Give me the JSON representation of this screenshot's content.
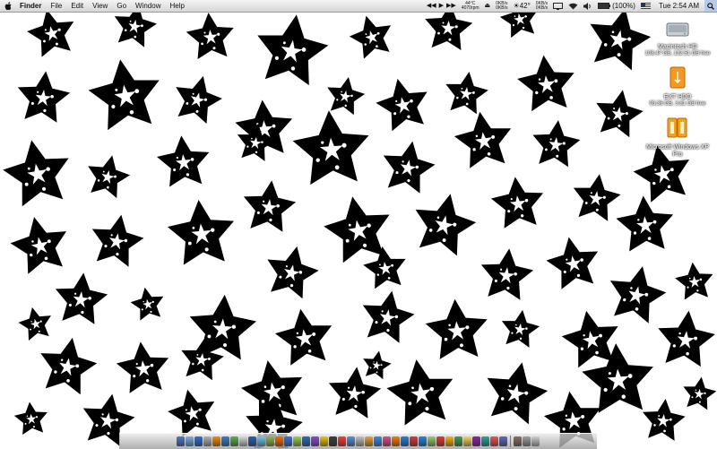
{
  "menubar": {
    "app_name": "Finder",
    "menus": [
      "File",
      "Edit",
      "View",
      "Go",
      "Window",
      "Help"
    ],
    "temperature_cpu": "44°C",
    "rpm": "4070rpm",
    "net_up": "0KB/s",
    "net_down": "0KB/s",
    "weather": "42°",
    "disk_io_1": "0KB/s",
    "disk_io_2": "0KB/s",
    "battery": "(100%)",
    "clock": "Tue 2:54 AM"
  },
  "desktop_icons": [
    {
      "name": "Macintosh HD",
      "sub": "108.47 GB, 132.51 GB free",
      "kind": "hard-drive-icon"
    },
    {
      "name": "EXT HDD",
      "sub": "93.36 GB, 3.81 GB free",
      "kind": "external-drive-icon"
    },
    {
      "name": "Microsoft Windows XP Pro",
      "sub": "",
      "kind": "windows-partition-icon"
    }
  ],
  "dock": {
    "colors": [
      "#4a7bd0",
      "#7bb0e8",
      "#2f6fd8",
      "#b2b2b2",
      "#ff8a00",
      "#3c7dc8",
      "#58b24a",
      "#d9d9d9",
      "#2b5fb8",
      "#6dc9f0",
      "#8fb84a",
      "#ff6a00",
      "#3476d4",
      "#9ad04a",
      "#2a6cc0",
      "#8a4ad0",
      "#f2c400",
      "#3c3c3c",
      "#ff3b30",
      "#5a8fd6",
      "#c0c0c0",
      "#f0a030",
      "#3a8cde",
      "#e04c8c",
      "#ff7a00",
      "#2680d8",
      "#d93b3b",
      "#1e88e5",
      "#9ccc65",
      "#e53935",
      "#ffb300",
      "#43a047",
      "#ffd54f",
      "#8e24aa",
      "#26a69a",
      "#ef5350",
      "#5c6bc0",
      "#8d6e63",
      "#a0a0a0",
      "#cfcfcf"
    ]
  }
}
